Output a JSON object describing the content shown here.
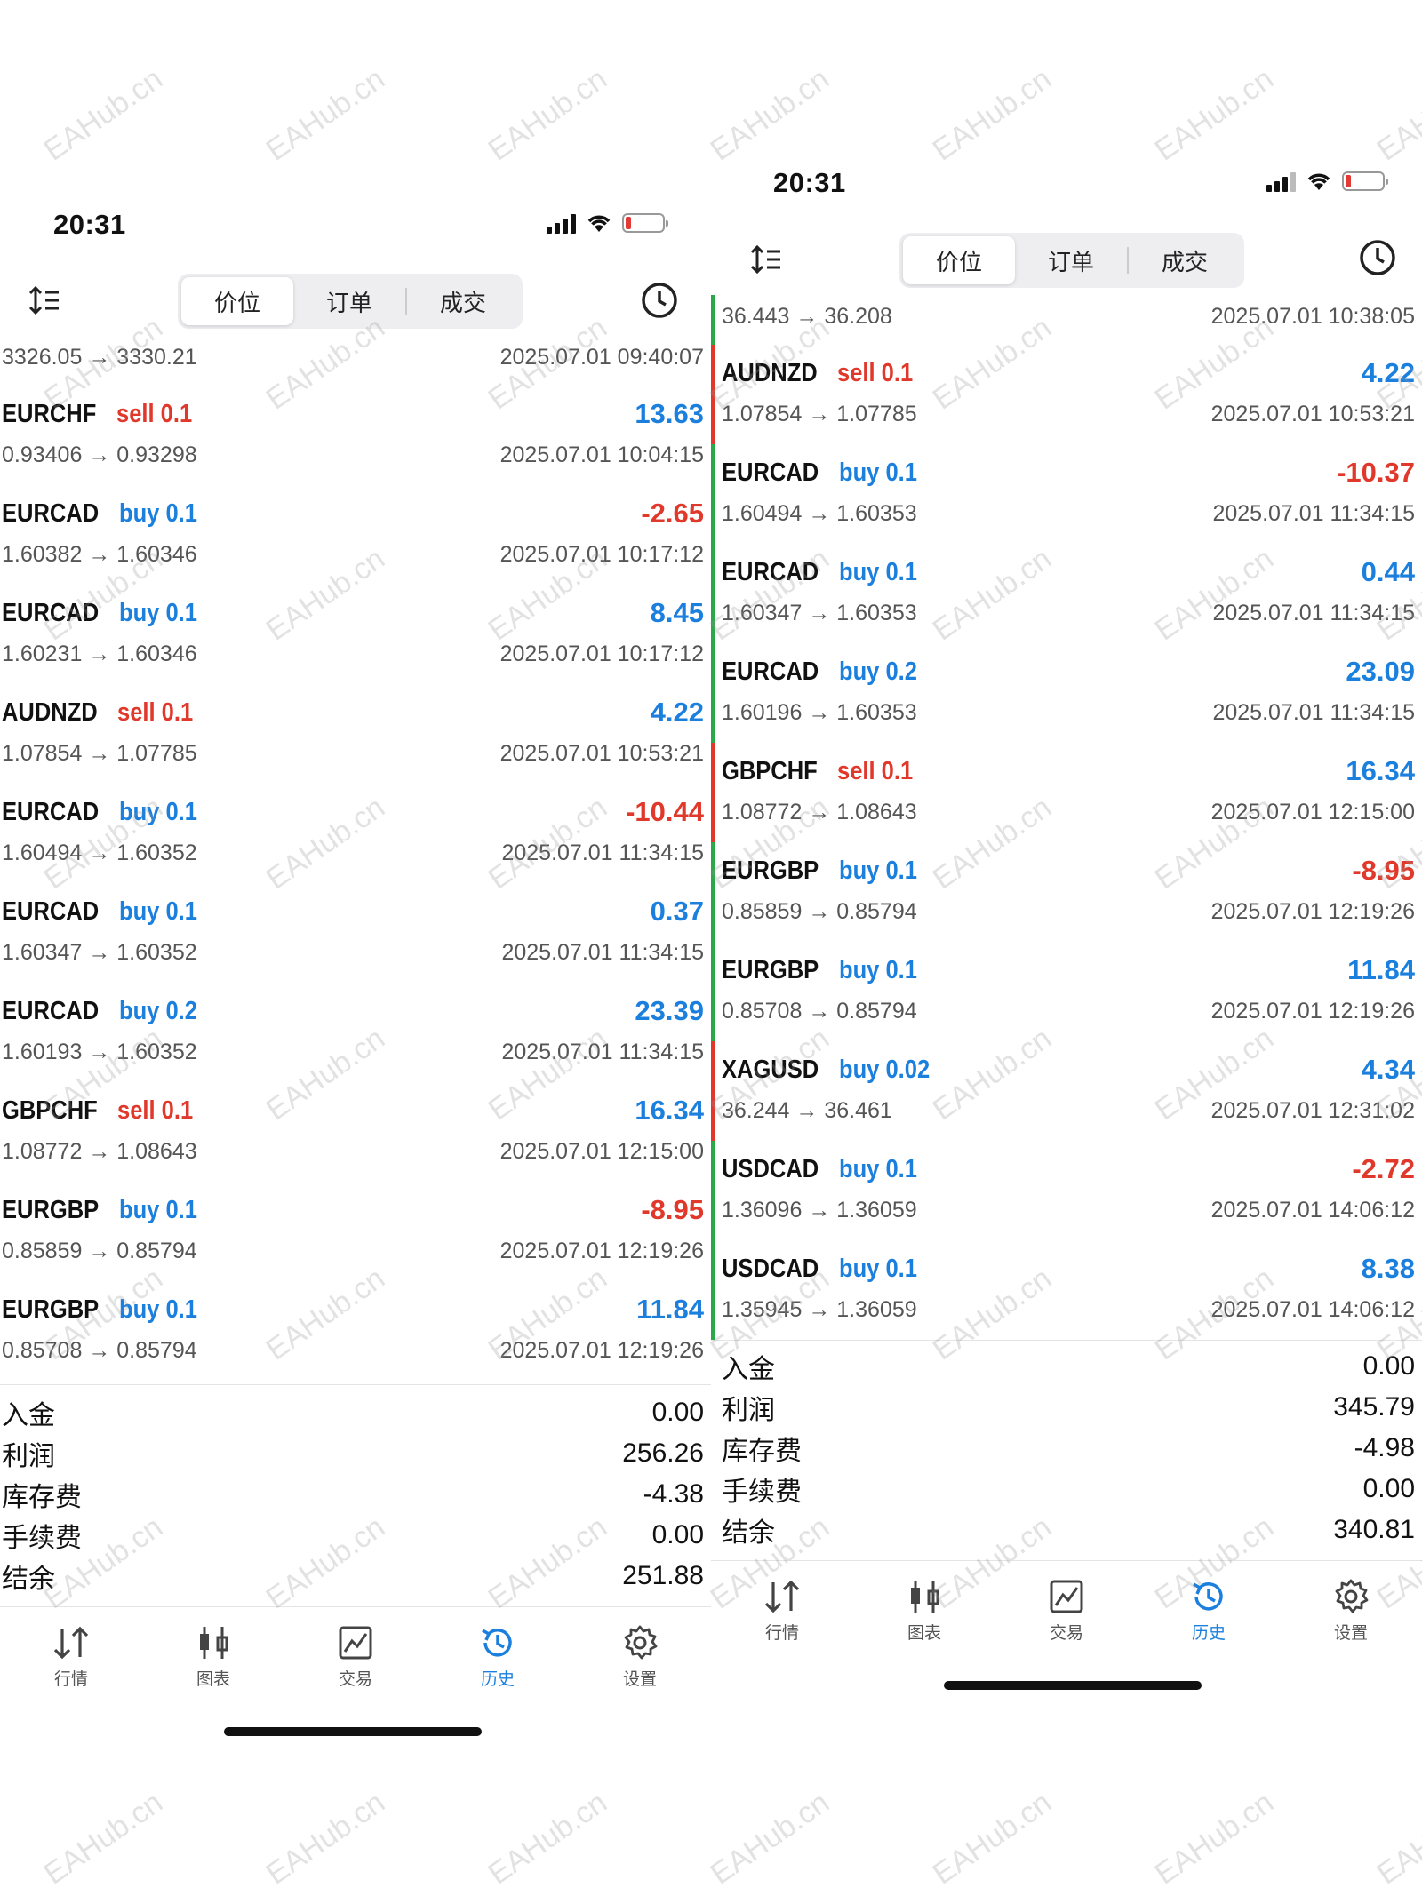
{
  "left": {
    "status": {
      "time": "20:31"
    },
    "tabs": [
      "价位",
      "订单",
      "成交"
    ],
    "partial_row": {
      "prices": "3326.05 → 3330.21",
      "time": "2025.07.01 09:40:07"
    },
    "trades": [
      {
        "symbol": "EURCHF",
        "dir": "sell",
        "lot": "0.1",
        "profit": "13.63",
        "prices": "0.93406 → 0.93298",
        "time": "2025.07.01 10:04:15"
      },
      {
        "symbol": "EURCAD",
        "dir": "buy",
        "lot": "0.1",
        "profit": "-2.65",
        "prices": "1.60382 → 1.60346",
        "time": "2025.07.01 10:17:12"
      },
      {
        "symbol": "EURCAD",
        "dir": "buy",
        "lot": "0.1",
        "profit": "8.45",
        "prices": "1.60231 → 1.60346",
        "time": "2025.07.01 10:17:12"
      },
      {
        "symbol": "AUDNZD",
        "dir": "sell",
        "lot": "0.1",
        "profit": "4.22",
        "prices": "1.07854 → 1.07785",
        "time": "2025.07.01 10:53:21"
      },
      {
        "symbol": "EURCAD",
        "dir": "buy",
        "lot": "0.1",
        "profit": "-10.44",
        "prices": "1.60494 → 1.60352",
        "time": "2025.07.01 11:34:15"
      },
      {
        "symbol": "EURCAD",
        "dir": "buy",
        "lot": "0.1",
        "profit": "0.37",
        "prices": "1.60347 → 1.60352",
        "time": "2025.07.01 11:34:15"
      },
      {
        "symbol": "EURCAD",
        "dir": "buy",
        "lot": "0.2",
        "profit": "23.39",
        "prices": "1.60193 → 1.60352",
        "time": "2025.07.01 11:34:15"
      },
      {
        "symbol": "GBPCHF",
        "dir": "sell",
        "lot": "0.1",
        "profit": "16.34",
        "prices": "1.08772 → 1.08643",
        "time": "2025.07.01 12:15:00"
      },
      {
        "symbol": "EURGBP",
        "dir": "buy",
        "lot": "0.1",
        "profit": "-8.95",
        "prices": "0.85859 → 0.85794",
        "time": "2025.07.01 12:19:26"
      },
      {
        "symbol": "EURGBP",
        "dir": "buy",
        "lot": "0.1",
        "profit": "11.84",
        "prices": "0.85708 → 0.85794",
        "time": "2025.07.01 12:19:26"
      }
    ],
    "summary": [
      {
        "label": "入金",
        "value": "0.00"
      },
      {
        "label": "利润",
        "value": "256.26"
      },
      {
        "label": "库存费",
        "value": "-4.38"
      },
      {
        "label": "手续费",
        "value": "0.00"
      },
      {
        "label": "结余",
        "value": "251.88"
      }
    ],
    "nav": [
      "行情",
      "图表",
      "交易",
      "历史",
      "设置"
    ]
  },
  "right": {
    "status": {
      "time": "20:31"
    },
    "tabs": [
      "价位",
      "订单",
      "成交"
    ],
    "partial_row": {
      "prices": "36.443 → 36.208",
      "time": "2025.07.01 10:38:05"
    },
    "trades": [
      {
        "symbol": "AUDNZD",
        "dir": "sell",
        "lot": "0.1",
        "profit": "4.22",
        "prices": "1.07854 → 1.07785",
        "time": "2025.07.01 10:53:21"
      },
      {
        "symbol": "EURCAD",
        "dir": "buy",
        "lot": "0.1",
        "profit": "-10.37",
        "prices": "1.60494 → 1.60353",
        "time": "2025.07.01 11:34:15"
      },
      {
        "symbol": "EURCAD",
        "dir": "buy",
        "lot": "0.1",
        "profit": "0.44",
        "prices": "1.60347 → 1.60353",
        "time": "2025.07.01 11:34:15"
      },
      {
        "symbol": "EURCAD",
        "dir": "buy",
        "lot": "0.2",
        "profit": "23.09",
        "prices": "1.60196 → 1.60353",
        "time": "2025.07.01 11:34:15"
      },
      {
        "symbol": "GBPCHF",
        "dir": "sell",
        "lot": "0.1",
        "profit": "16.34",
        "prices": "1.08772 → 1.08643",
        "time": "2025.07.01 12:15:00"
      },
      {
        "symbol": "EURGBP",
        "dir": "buy",
        "lot": "0.1",
        "profit": "-8.95",
        "prices": "0.85859 → 0.85794",
        "time": "2025.07.01 12:19:26"
      },
      {
        "symbol": "EURGBP",
        "dir": "buy",
        "lot": "0.1",
        "profit": "11.84",
        "prices": "0.85708 → 0.85794",
        "time": "2025.07.01 12:19:26"
      },
      {
        "symbol": "XAGUSD",
        "dir": "buy",
        "lot": "0.02",
        "profit": "4.34",
        "prices": "36.244 → 36.461",
        "time": "2025.07.01 12:31:02"
      },
      {
        "symbol": "USDCAD",
        "dir": "buy",
        "lot": "0.1",
        "profit": "-2.72",
        "prices": "1.36096 → 1.36059",
        "time": "2025.07.01 14:06:12"
      },
      {
        "symbol": "USDCAD",
        "dir": "buy",
        "lot": "0.1",
        "profit": "8.38",
        "prices": "1.35945 → 1.36059",
        "time": "2025.07.01 14:06:12"
      }
    ],
    "summary": [
      {
        "label": "入金",
        "value": "0.00"
      },
      {
        "label": "利润",
        "value": "345.79"
      },
      {
        "label": "库存费",
        "value": "-4.98"
      },
      {
        "label": "手续费",
        "value": "0.00"
      },
      {
        "label": "结余",
        "value": "340.81"
      }
    ],
    "nav": [
      "行情",
      "图表",
      "交易",
      "历史",
      "设置"
    ]
  },
  "watermark": "EAHub.cn",
  "colors": {
    "buy": "#1b7fde",
    "sell": "#e0392b",
    "active_tab": "#1b7fde",
    "marker_green": "#2aa84a",
    "marker_red": "#e0392b"
  }
}
